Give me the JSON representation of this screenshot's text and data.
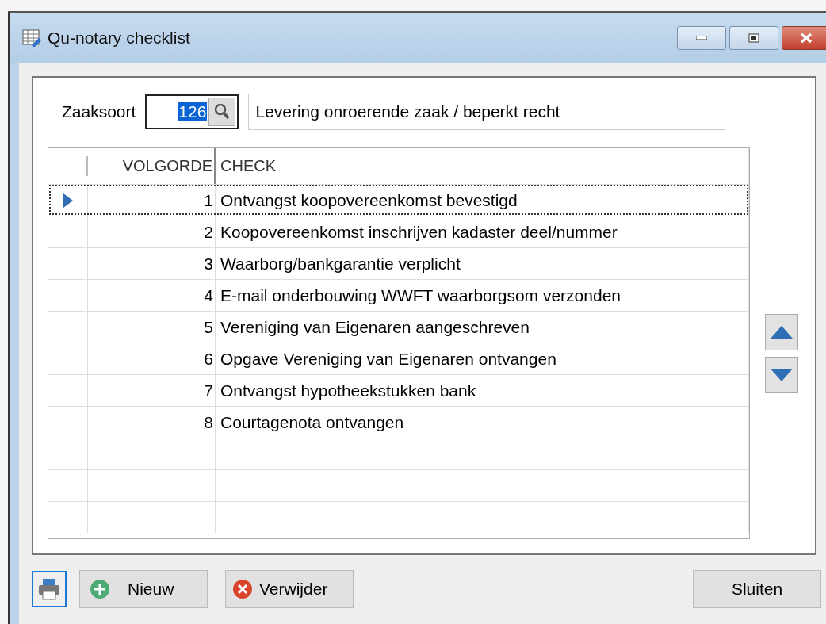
{
  "window": {
    "title": "Qu-notary checklist"
  },
  "zaaksoort": {
    "label": "Zaaksoort",
    "code": "126",
    "code_selected": true,
    "description": "Levering onroerende zaak / beperkt recht"
  },
  "table": {
    "columns": [
      "VOLGORDE",
      "CHECK"
    ],
    "rows": [
      {
        "volgorde": "1",
        "check": "Ontvangst koopovereenkomst bevestigd",
        "selected": true
      },
      {
        "volgorde": "2",
        "check": "Koopovereenkomst inschrijven kadaster deel/nummer",
        "selected": false
      },
      {
        "volgorde": "3",
        "check": "Waarborg/bankgarantie verplicht",
        "selected": false
      },
      {
        "volgorde": "4",
        "check": "E-mail onderbouwing WWFT waarborgsom verzonden",
        "selected": false
      },
      {
        "volgorde": "5",
        "check": "Vereniging van Eigenaren aangeschreven",
        "selected": false
      },
      {
        "volgorde": "6",
        "check": "Opgave Vereniging van Eigenaren ontvangen",
        "selected": false
      },
      {
        "volgorde": "7",
        "check": "Ontvangst hypotheekstukken bank",
        "selected": false
      },
      {
        "volgorde": "8",
        "check": "Courtagenota ontvangen",
        "selected": false
      }
    ]
  },
  "buttons": {
    "new": "Nieuw",
    "delete": "Verwijder",
    "close": "Sluiten"
  }
}
